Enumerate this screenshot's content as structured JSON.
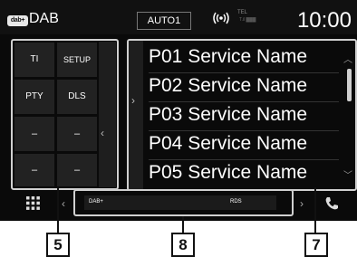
{
  "status_bar": {
    "source_logo": "dab+",
    "source_label": "DAB",
    "mode": "AUTO1",
    "tel_label": "TEL",
    "tel_bars": "T.il ▓▓▓",
    "clock": "10:00"
  },
  "controls": {
    "buttons": [
      {
        "label": "TI"
      },
      {
        "label": "SETUP"
      },
      {
        "label": "PTY"
      },
      {
        "label": "DLS"
      },
      {
        "label": "–"
      },
      {
        "label": "–"
      },
      {
        "label": "–"
      },
      {
        "label": "–"
      }
    ]
  },
  "preset_list": {
    "items": [
      {
        "label": "P01 Service Name"
      },
      {
        "label": "P02 Service Name"
      },
      {
        "label": "P03 Service Name"
      },
      {
        "label": "P04 Service Name"
      },
      {
        "label": "P05 Service Name"
      }
    ]
  },
  "info_bar": {
    "left_text": "DAB+",
    "right_text": "RDS"
  },
  "callouts": {
    "c5": "5",
    "c8": "8",
    "c7": "7"
  }
}
